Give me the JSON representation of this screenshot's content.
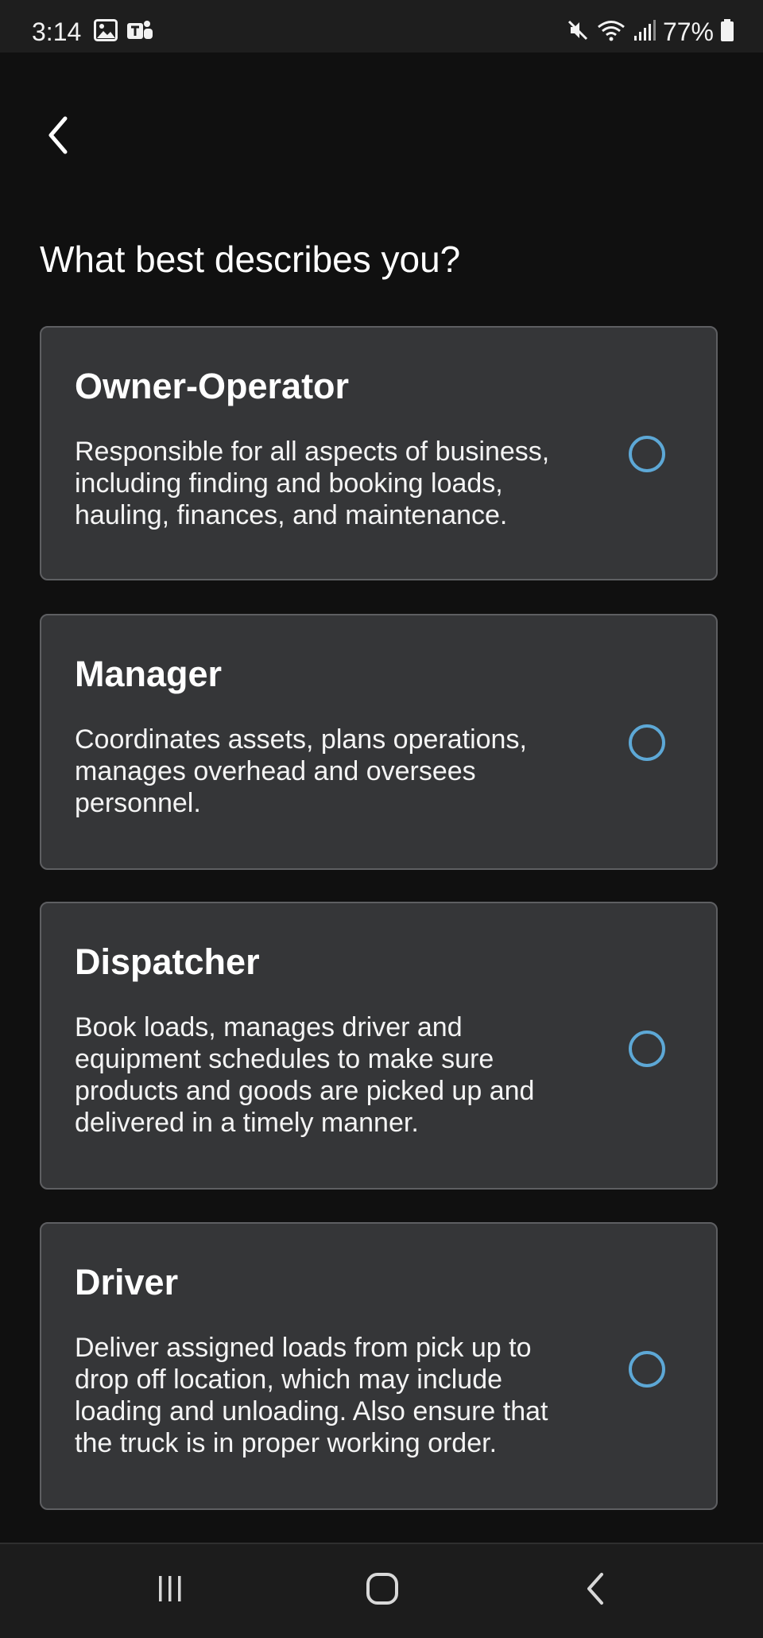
{
  "status_bar": {
    "time": "3:14",
    "left_icons": [
      "image-icon",
      "teams-icon"
    ],
    "right_icons": [
      "mute-icon",
      "wifi-icon",
      "signal-icon",
      "battery-icon"
    ],
    "battery": "77%"
  },
  "header": {
    "back_icon": "chevron-left-icon"
  },
  "page": {
    "title": "What best describes you?"
  },
  "options": [
    {
      "title": "Owner-Operator",
      "description": "Responsible for all aspects of business, including finding and booking loads, hauling, finances, and maintenance.",
      "selected": false
    },
    {
      "title": "Manager",
      "description": "Coordinates assets, plans operations, manages overhead and oversees personnel.",
      "selected": false
    },
    {
      "title": "Dispatcher",
      "description": "Book loads, manages driver and equipment schedules to make sure products and goods are picked up and delivered in a timely manner.",
      "selected": false
    },
    {
      "title": "Driver",
      "description": "Deliver assigned loads from pick up to drop off location, which may include loading and unloading. Also ensure that the truck is in proper working order.",
      "selected": false
    }
  ],
  "nav_bar": {
    "buttons": [
      "recents-icon",
      "home-icon",
      "back-icon"
    ]
  },
  "colors": {
    "background": "#101010",
    "card": "#353638",
    "card_border": "#5e5f62",
    "radio_accent": "#5da8d6"
  }
}
